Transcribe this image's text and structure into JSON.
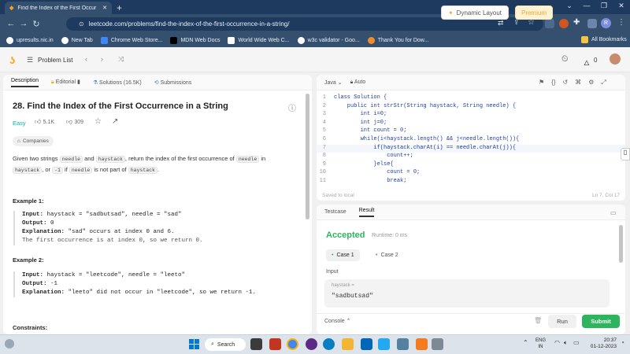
{
  "browser": {
    "tab_title": "Find the Index of the First Occur",
    "url": "leetcode.com/problems/find-the-index-of-the-first-occurrence-in-a-string/",
    "profile_initial": "R",
    "bookmarks": [
      "upresults.nic.in",
      "New Tab",
      "Chrome Web Store...",
      "MDN Web Docs",
      "World Wide Web C...",
      "w3c validator - Goo...",
      "Thank You for Dow..."
    ],
    "all_bookmarks": "All Bookmarks"
  },
  "nav": {
    "problem_list": "Problem List",
    "dynamic_layout": "Dynamic Layout",
    "premium": "Premium",
    "streak": "0"
  },
  "left": {
    "tabs": {
      "description": "Description",
      "editorial": "Editorial",
      "solutions": "Solutions (16.5K)",
      "submissions": "Submissions"
    },
    "title": "28. Find the Index of the First Occurrence in a String",
    "difficulty": "Easy",
    "likes": "5.1K",
    "dislikes": "309",
    "companies": "Companies",
    "desc": {
      "p1": "Given two strings ",
      "needle": "needle",
      "and": " and ",
      "haystack": "haystack",
      "p2": ", return the index of the first occurrence of ",
      "p3": " in",
      "p4": ", or ",
      "neg1": "-1",
      "p5": " if ",
      "p6": " is not part of ",
      "p7": "."
    },
    "ex1": {
      "label": "Example 1:",
      "input_k": "Input:",
      "input_v": " haystack = \"sadbutsad\", needle = \"sad\"",
      "output_k": "Output:",
      "output_v": " 0",
      "expl_k": "Explanation:",
      "expl_v": " \"sad\" occurs at index 0 and 6.",
      "expl_2": "The first occurrence is at index 0, so we return 0."
    },
    "ex2": {
      "label": "Example 2:",
      "input_k": "Input:",
      "input_v": " haystack = \"leetcode\", needle = \"leeto\"",
      "output_k": "Output:",
      "output_v": " -1",
      "expl_k": "Explanation:",
      "expl_v": " \"leeto\" did not occur in \"leetcode\", so we return -1."
    },
    "constraints": "Constraints:"
  },
  "editor": {
    "language": "Java",
    "mode": "Auto",
    "saved": "Saved to local",
    "cursor": "Ln 7, Col 17",
    "lines": [
      {
        "n": "1",
        "t": "class Solution {"
      },
      {
        "n": "2",
        "t": "    public int strStr(String haystack, String needle) {"
      },
      {
        "n": "3",
        "t": "        int i=0;"
      },
      {
        "n": "4",
        "t": "        int j=0;"
      },
      {
        "n": "5",
        "t": "        int count = 0;"
      },
      {
        "n": "6",
        "t": "        while(i<haystack.length() && j<needle.length()){"
      },
      {
        "n": "7",
        "t": "            if(haystack.charAt(i) == needle.charAt(j)){"
      },
      {
        "n": "8",
        "t": "                count++;"
      },
      {
        "n": "9",
        "t": "            }else{"
      },
      {
        "n": "10",
        "t": "                count = 0;"
      },
      {
        "n": "11",
        "t": "                break;"
      }
    ]
  },
  "result": {
    "tabs": {
      "testcase": "Testcase",
      "result": "Result"
    },
    "status": "Accepted",
    "runtime": "Runtime: 0 ms",
    "case1": "Case 1",
    "case2": "Case 2",
    "input_label": "Input",
    "var_name": "haystack =",
    "var_value": "\"sadbutsad\"",
    "console": "Console",
    "run": "Run",
    "submit": "Submit"
  },
  "taskbar": {
    "search": "Search",
    "lang1": "ENG",
    "lang2": "IN",
    "time": "20:37",
    "date": "01-12-2023"
  },
  "colors": {
    "accent_green": "#2db55d",
    "easy": "#00b8a3",
    "premium_bg": "#fff3d6",
    "premium_text": "#f5a623",
    "chrome_dark": "#1e3a5f",
    "chrome_mid": "#35506f"
  }
}
